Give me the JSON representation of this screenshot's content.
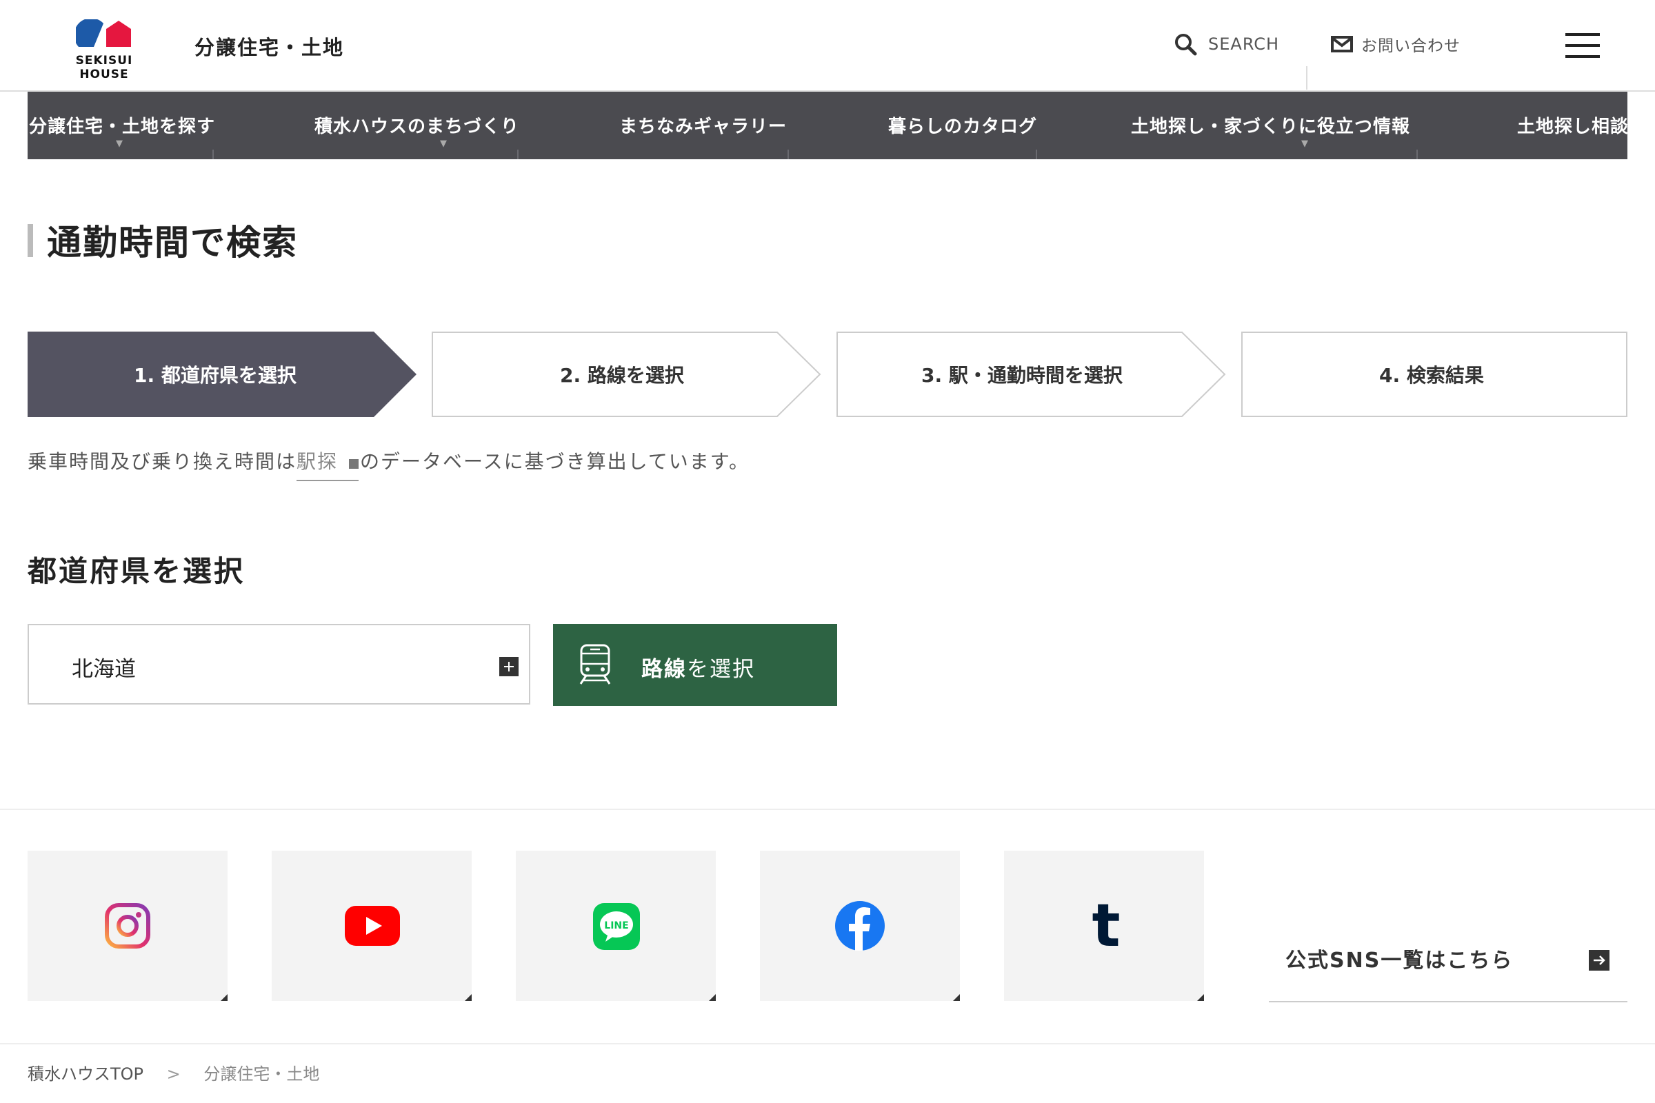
{
  "header": {
    "logo_text": "SEKISUI HOUSE",
    "site_title": "分譲住宅・土地",
    "search_label": "SEARCH",
    "contact_label": "お問い合わせ"
  },
  "nav": {
    "items": [
      {
        "label": "分譲住宅・土地を探す",
        "has_dropdown": true
      },
      {
        "label": "積水ハウスのまちづくり",
        "has_dropdown": true
      },
      {
        "label": "まちなみギャラリー",
        "has_dropdown": false
      },
      {
        "label": "暮らしのカタログ",
        "has_dropdown": false
      },
      {
        "label": "土地探し・家づくりに役立つ情報",
        "has_dropdown": true
      },
      {
        "label": "土地探し相談",
        "has_dropdown": false
      }
    ],
    "caret": "▼"
  },
  "page": {
    "title": "通勤時間で検索",
    "steps": [
      {
        "label": "1. 都道府県を選択",
        "active": true
      },
      {
        "label": "2. 路線を選択",
        "active": false
      },
      {
        "label": "3. 駅・通勤時間を選択",
        "active": false
      },
      {
        "label": "4. 検索結果",
        "active": false
      }
    ],
    "note_before": "乗車時間及び乗り換え時間は",
    "note_link": "駅探",
    "note_after": "のデータベースに基づき算出しています。",
    "section_title": "都道府県を選択",
    "prefecture_value": "北海道",
    "route_button_bold": "路線",
    "route_button_rest": "を選択"
  },
  "sns": {
    "items": [
      "instagram",
      "youtube",
      "line",
      "facebook",
      "tumblr"
    ],
    "line_text": "LINE",
    "tumblr_text": "t",
    "link_label": "公式SNS一覧はこちら"
  },
  "breadcrumb": {
    "home": "積水ハウスTOP",
    "separator": ">",
    "current": "分譲住宅・土地"
  },
  "colors": {
    "nav_bg": "#4b4b50",
    "active_step": "#545361",
    "route_button": "#2d6343",
    "brand_blue": "#1d5aa8",
    "brand_red": "#e5173f"
  }
}
